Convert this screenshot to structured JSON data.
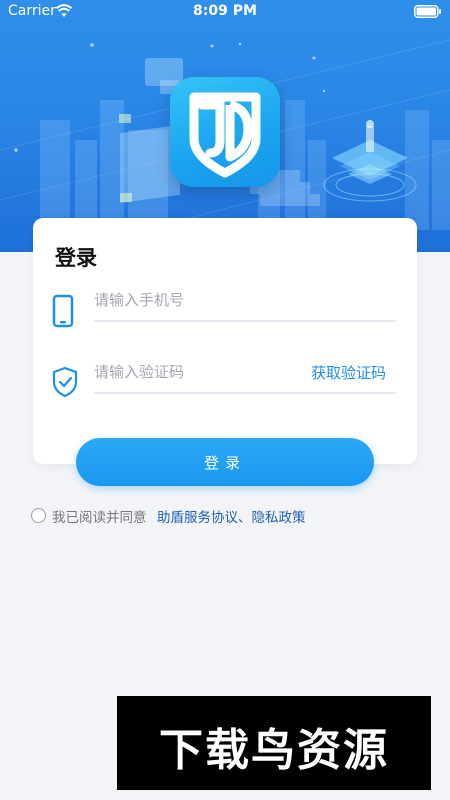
{
  "status_bar": {
    "carrier": "Carrier",
    "time": "8:09 PM"
  },
  "login_card": {
    "title": "登录",
    "phone_placeholder": "请输入手机号",
    "code_placeholder": "请输入验证码",
    "get_code_label": "获取验证码"
  },
  "login_button": {
    "label": "登录"
  },
  "agreement": {
    "text": "我已阅读并同意",
    "link": "助盾服务协议、隐私政策"
  },
  "watermark": {
    "text": "下载鸟资源"
  },
  "colors": {
    "hero_blue": "#2f8fea",
    "accent": "#1e8ee9",
    "button_blue": "#1a98ef",
    "link_blue": "#1d5fb6",
    "background": "#f2f4f8"
  },
  "icons": [
    "wifi-icon",
    "battery-icon",
    "app-logo-icon",
    "phone-icon",
    "shield-check-icon",
    "radio-icon"
  ]
}
